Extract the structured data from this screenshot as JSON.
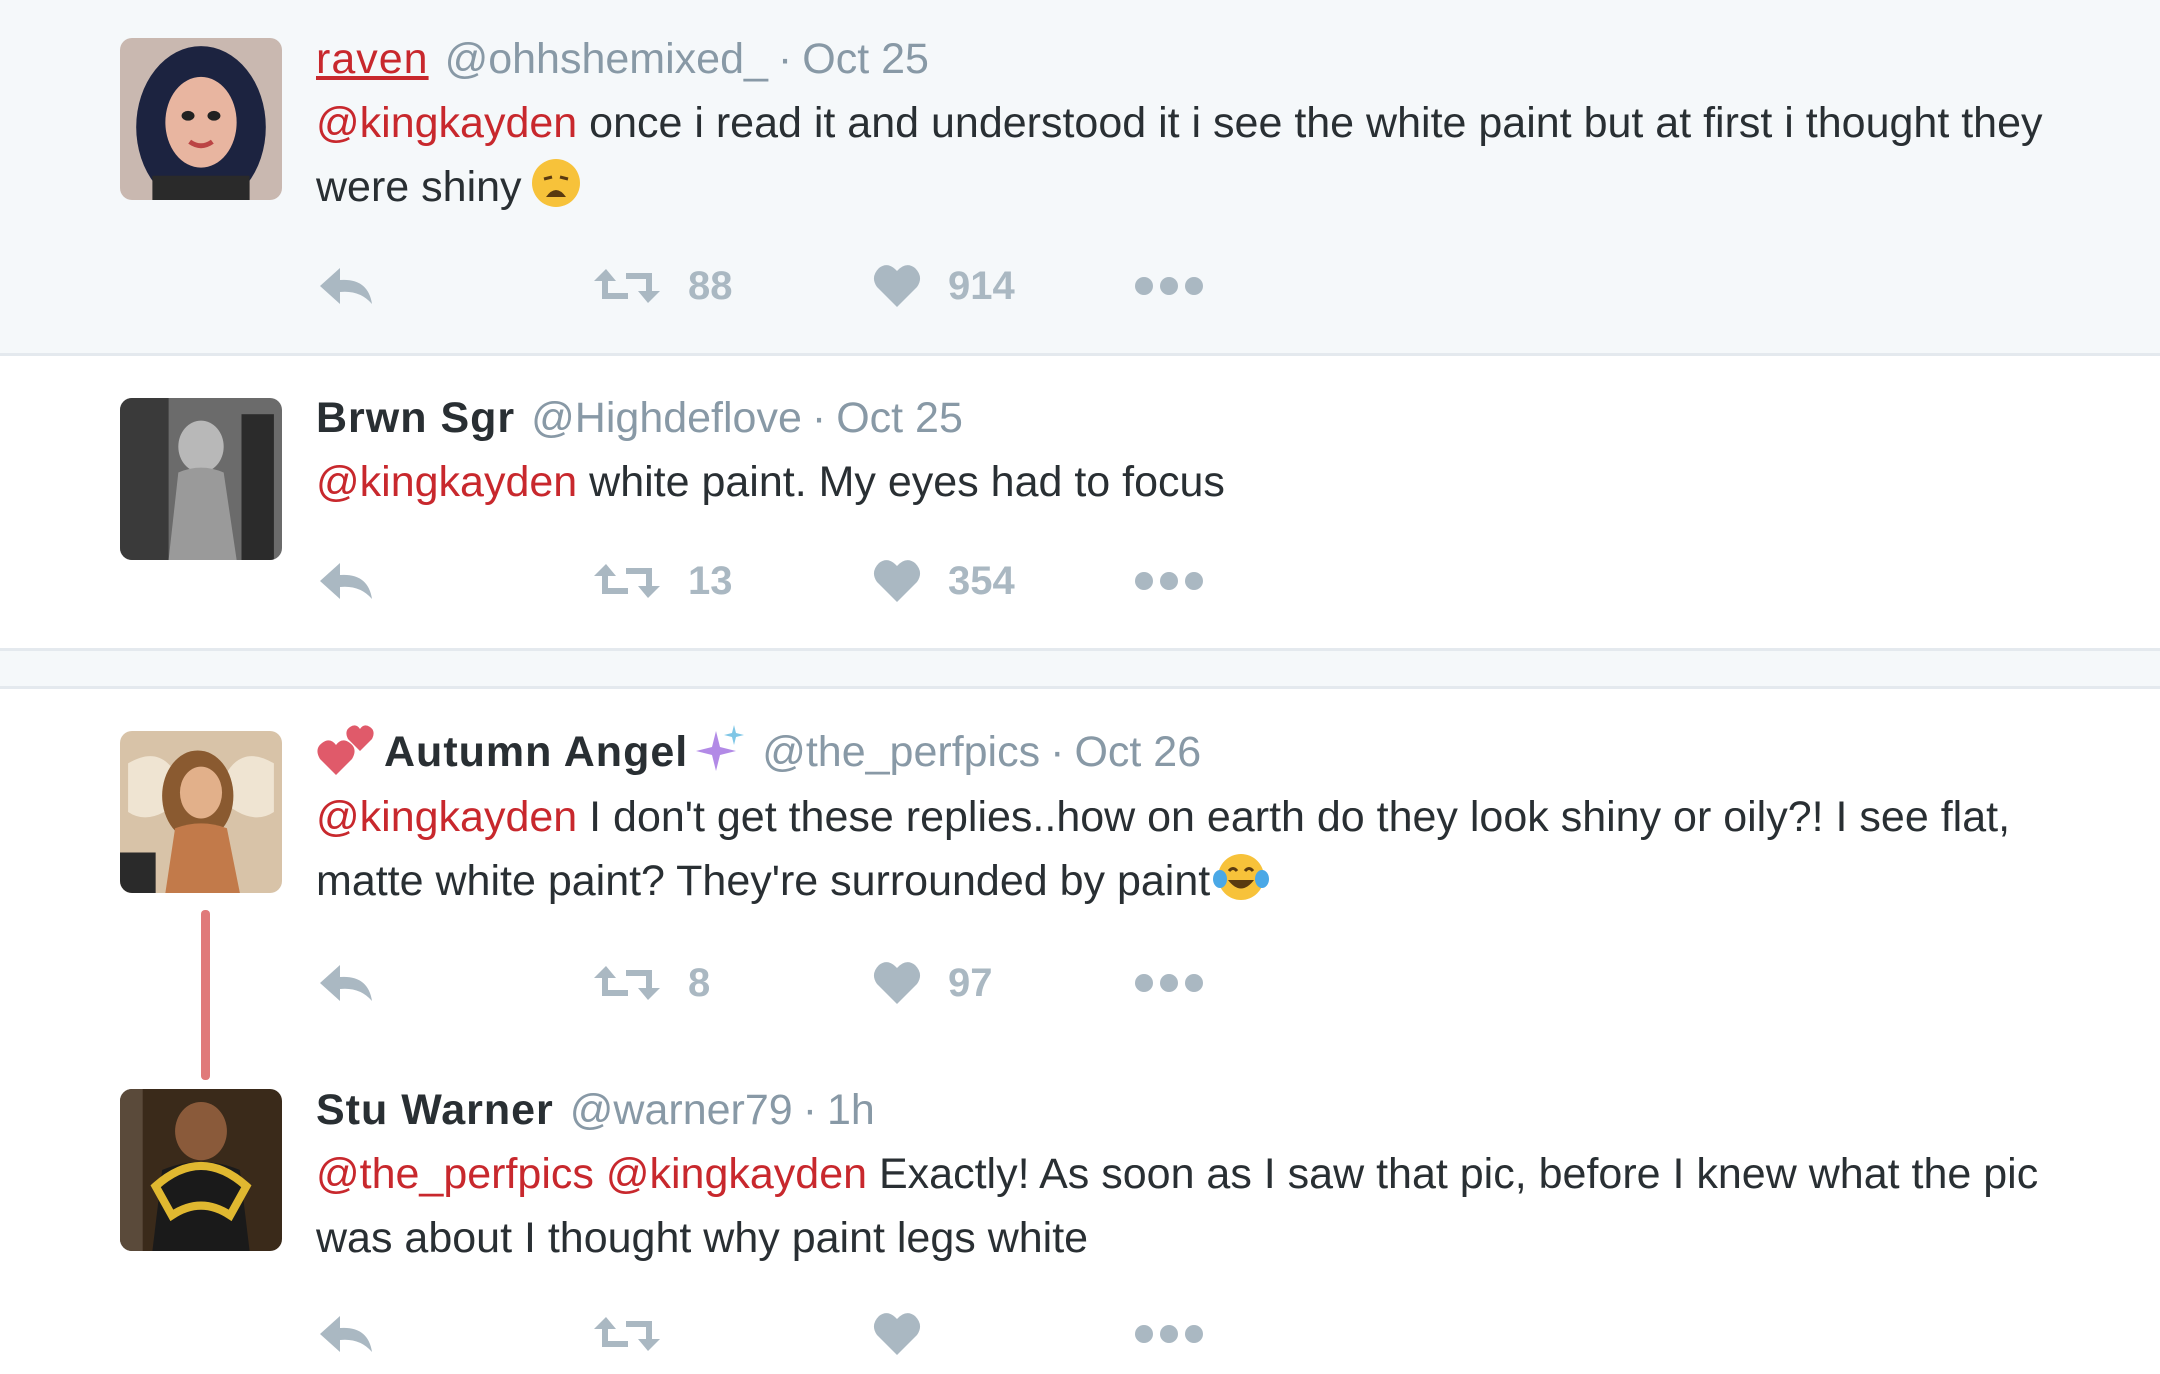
{
  "tweets": [
    {
      "name": "raven",
      "handle": "@ohhshemixed_",
      "sep": "·",
      "time": "Oct 25",
      "mention": "@kingkayden",
      "body": " once i read it and understood it i see the white paint but at first i thought they were shiny",
      "emoji": "weary-face",
      "retweets": "88",
      "likes": "914"
    },
    {
      "name": "Brwn Sgr",
      "handle": "@Highdeflove",
      "sep": "·",
      "time": "Oct 25",
      "mention": "@kingkayden",
      "body": " white paint. My eyes had to focus",
      "retweets": "13",
      "likes": "354"
    },
    {
      "name": "Autumn Angel",
      "name_prefix_emoji": "two-hearts",
      "name_suffix_emoji": "sparkles",
      "handle": "@the_perfpics",
      "sep": "·",
      "time": "Oct 26",
      "mention": "@kingkayden",
      "body": " I don't get these replies..how on earth do they look shiny or oily?! I see flat, matte white paint? They're surrounded by paint",
      "emoji": "face-with-tears-of-joy",
      "retweets": "8",
      "likes": "97"
    },
    {
      "name": "Stu Warner",
      "handle": "@warner79",
      "sep": "·",
      "time": "1h",
      "mention": "@the_perfpics @kingkayden",
      "body": " Exactly! As soon as I saw that pic, before I knew what the pic was about I thought why paint legs white",
      "retweets": "",
      "likes": ""
    }
  ],
  "icons": [
    "reply-icon",
    "retweet-icon",
    "heart-icon",
    "more-icon"
  ],
  "colors": {
    "mention": "#c8282d",
    "muted": "#8899a6",
    "action": "#aab8c2",
    "highlight_bg": "#f5f8fa",
    "thread_line": "#e07a7a"
  }
}
